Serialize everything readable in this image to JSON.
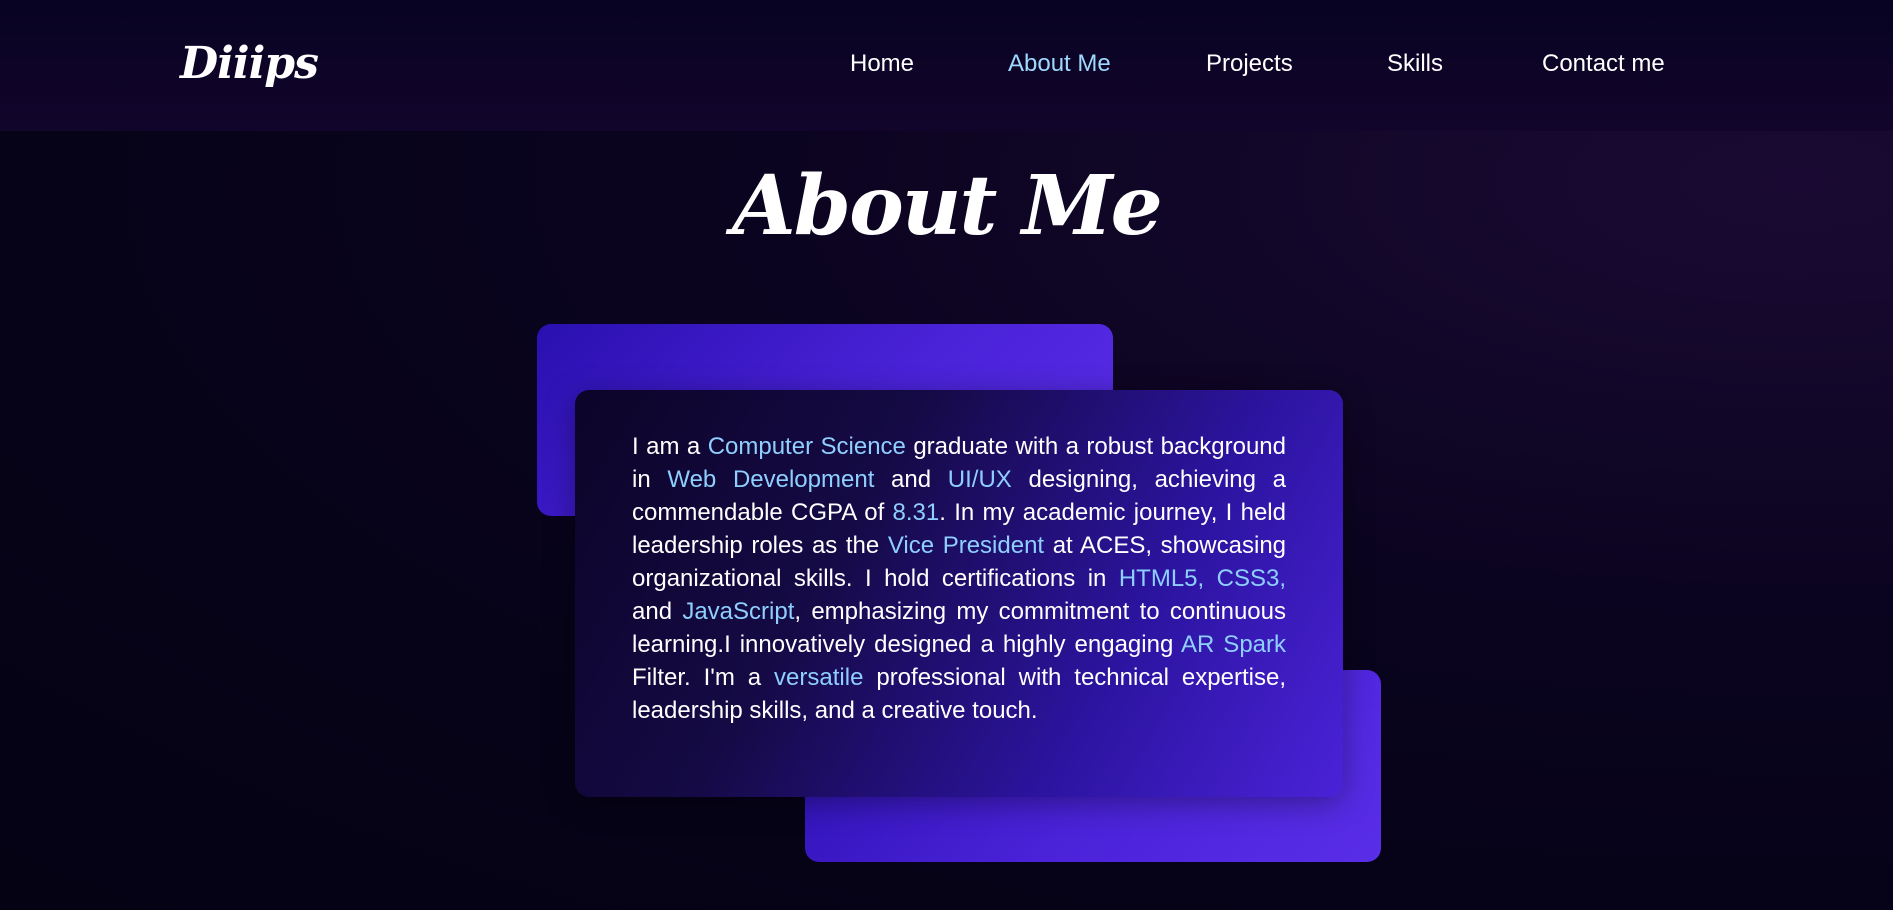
{
  "header": {
    "logo": "Diiips",
    "nav": [
      {
        "label": "Home",
        "active": false
      },
      {
        "label": "About Me",
        "active": true
      },
      {
        "label": "Projects",
        "active": false
      },
      {
        "label": "Skills",
        "active": false
      },
      {
        "label": "Contact me",
        "active": false
      }
    ]
  },
  "main": {
    "title": "About Me",
    "about": {
      "t1": "I am a ",
      "h1": "Computer Science",
      "t2": " graduate with a robust background in ",
      "h2": "Web Development",
      "t3": " and ",
      "h3": "UI/UX",
      "t4": " designing, achieving a commendable CGPA of ",
      "h4": "8.31",
      "t5": ". In my academic journey, I held leadership roles as the ",
      "h5": "Vice President",
      "t6": " at ACES, showcasing organizational skills. I hold certifications in ",
      "h6": "HTML5,",
      "t7": " ",
      "h7": "CSS3,",
      "t8": " and ",
      "h8": "JavaScript",
      "t9": ", emphasizing my commitment to continuous learning.I innovatively designed a highly engaging ",
      "h9": "AR Spark",
      "t10": " Filter. I'm a ",
      "h10": "versatile",
      "t11": " professional with technical expertise, leadership skills, and a creative touch."
    }
  },
  "colors": {
    "accent": "#8fcfff",
    "nav_active": "#9fd8ff",
    "card_purple": "#4a22d8",
    "background": "#060318"
  }
}
